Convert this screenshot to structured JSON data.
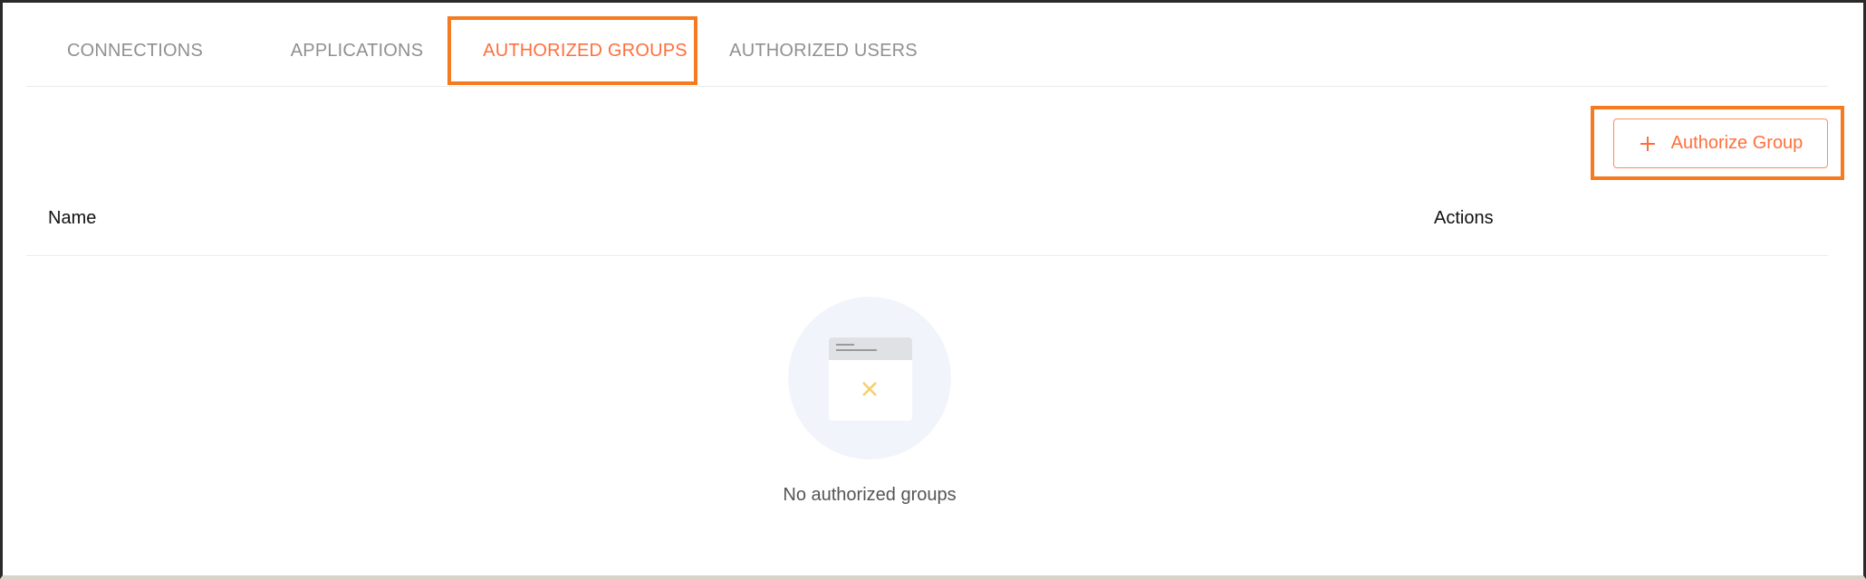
{
  "tabs": [
    {
      "label": "CONNECTIONS",
      "active": false
    },
    {
      "label": "APPLICATIONS",
      "active": false
    },
    {
      "label": "AUTHORIZED GROUPS",
      "active": true
    },
    {
      "label": "AUTHORIZED USERS",
      "active": false
    }
  ],
  "toolbar": {
    "authorize_label": "Authorize Group",
    "authorize_icon": "plus-icon"
  },
  "table": {
    "columns": [
      "Name",
      "Actions"
    ]
  },
  "empty_state": {
    "icon": "empty-window-icon",
    "message": "No authorized groups"
  },
  "colors": {
    "accent": "#ff6f3c",
    "highlight": "#f47b20",
    "inactive_tab": "#909090"
  }
}
